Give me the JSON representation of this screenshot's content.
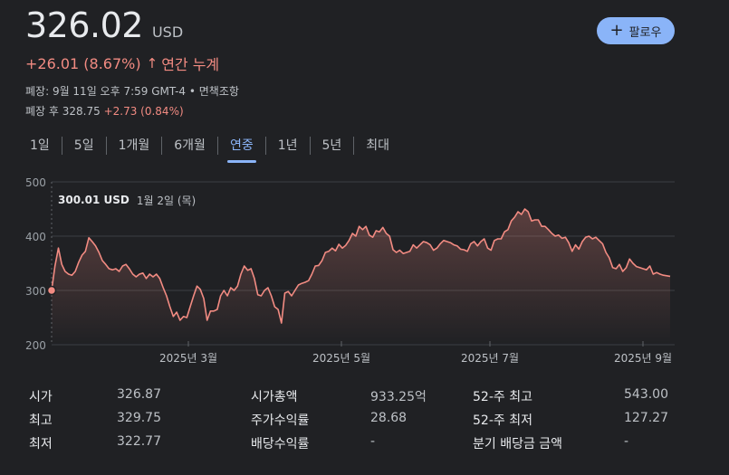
{
  "quote": {
    "price": "326.02",
    "currency": "USD",
    "change": "+26.01 (8.67%)",
    "change_arrow": "↑",
    "change_period": "연간 누계",
    "closed_info": "폐장: 9월 11일 오후 7:59 GMT-4 • 면책조항",
    "after_hours_label": "폐장 후 328.75",
    "after_hours_change": "+2.73 (0.84%)"
  },
  "follow": {
    "plus": "+",
    "label": "팔로우"
  },
  "tabs": [
    {
      "label": "1일"
    },
    {
      "label": "5일"
    },
    {
      "label": "1개월"
    },
    {
      "label": "6개월"
    },
    {
      "label": "연중"
    },
    {
      "label": "1년"
    },
    {
      "label": "5년"
    },
    {
      "label": "최대"
    }
  ],
  "active_tab": "연중",
  "tooltip": {
    "value": "300.01 USD",
    "date": "1월 2일 (목)"
  },
  "colors": {
    "line": "#f28b82",
    "accent": "#8ab4f8",
    "background": "#202124"
  },
  "chart_data": {
    "type": "line",
    "ylim": [
      200,
      500
    ],
    "yticks": [
      "500",
      "400",
      "300",
      "200"
    ],
    "xticks": [
      "2025년 3월",
      "2025년 5월",
      "2025년 7월",
      "2025년 9월"
    ],
    "baseline": 300.01,
    "series": [
      {
        "values": [
          300,
          345,
          378,
          348,
          335,
          330,
          328,
          335,
          352,
          365,
          372,
          397,
          390,
          382,
          370,
          355,
          348,
          340,
          338,
          340,
          335,
          345,
          348,
          340,
          330,
          325,
          330,
          332,
          322,
          330,
          325,
          330,
          322,
          305,
          290,
          270,
          252,
          260,
          245,
          252,
          250,
          270,
          290,
          308,
          302,
          285,
          245,
          262,
          262,
          265,
          290,
          300,
          290,
          305,
          300,
          308,
          330,
          345,
          337,
          340,
          322,
          292,
          290,
          300,
          305,
          290,
          270,
          265,
          240,
          295,
          298,
          290,
          300,
          310,
          313,
          315,
          318,
          330,
          345,
          346,
          355,
          370,
          372,
          378,
          373,
          385,
          378,
          383,
          392,
          405,
          400,
          418,
          412,
          418,
          402,
          398,
          410,
          408,
          416,
          405,
          400,
          375,
          370,
          374,
          368,
          370,
          372,
          384,
          378,
          384,
          390,
          388,
          384,
          374,
          378,
          386,
          392,
          390,
          388,
          384,
          382,
          376,
          375,
          372,
          386,
          390,
          382,
          390,
          395,
          378,
          374,
          392,
          395,
          395,
          408,
          412,
          428,
          435,
          445,
          440,
          450,
          445,
          428,
          430,
          430,
          418,
          418,
          412,
          405,
          400,
          402,
          396,
          398,
          388,
          372,
          384,
          376,
          390,
          398,
          400,
          395,
          398,
          392,
          386,
          370,
          360,
          342,
          340,
          348,
          335,
          342,
          358,
          350,
          344,
          342,
          340,
          338,
          345,
          330,
          333,
          330,
          328,
          327,
          326
        ]
      }
    ]
  },
  "stats": [
    {
      "label": "시가",
      "value": "326.87"
    },
    {
      "label": "최고",
      "value": "329.75"
    },
    {
      "label": "최저",
      "value": "322.77"
    },
    {
      "label": "시가총액",
      "value": "933.25억"
    },
    {
      "label": "주가수익률",
      "value": "28.68"
    },
    {
      "label": "배당수익률",
      "value": "-"
    },
    {
      "label": "52-주 최고",
      "value": "543.00"
    },
    {
      "label": "52-주 최저",
      "value": "127.27"
    },
    {
      "label": "분기 배당금 금액",
      "value": "-"
    }
  ]
}
